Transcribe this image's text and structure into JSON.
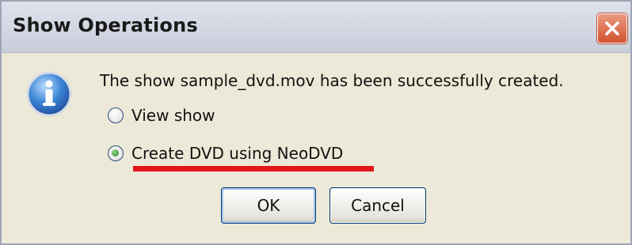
{
  "window": {
    "title": "Show Operations"
  },
  "message": "The show sample_dvd.mov has been successfully created.",
  "options": [
    {
      "label": "View show",
      "selected": false
    },
    {
      "label": "Create DVD using NeoDVD",
      "selected": true
    }
  ],
  "buttons": {
    "ok_label": "OK",
    "cancel_label": "Cancel"
  },
  "icons": {
    "info": "info-icon",
    "close": "close-icon"
  },
  "colors": {
    "annotation_underline": "#e3141a",
    "close_button": "#d2522f",
    "info_icon": "#2f6fc4"
  }
}
